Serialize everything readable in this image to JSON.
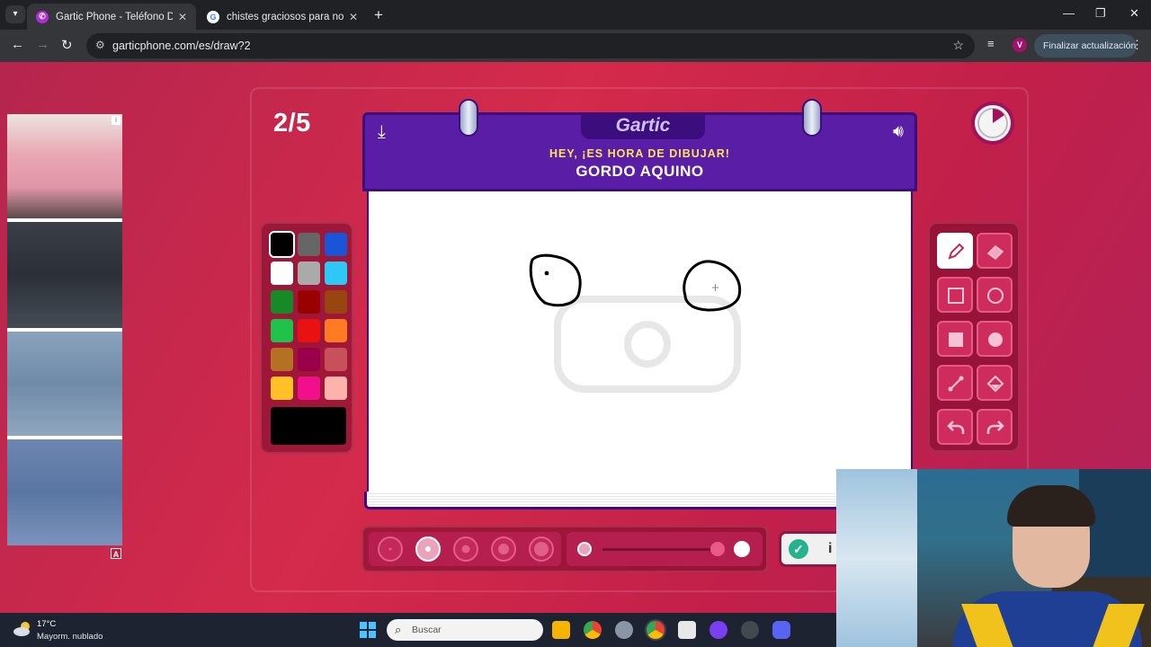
{
  "browser": {
    "tabs": [
      {
        "title": "Gartic Phone - Teléfono Descon",
        "active": true
      },
      {
        "title": "chistes graciosos para no parar",
        "active": false
      }
    ],
    "url": "garticphone.com/es/draw?2",
    "profile_initial": "V",
    "update_label": "Finalizar actualización"
  },
  "game": {
    "round": "2/5",
    "logo": "Gartic",
    "subtitle": "HEY, ¡ES HORA DE DIBUJAR!",
    "word": "GORDO AQUINO",
    "done_label": "i",
    "colors": [
      "#000000",
      "#666666",
      "#1a55d8",
      "#ffffff",
      "#aaaaaa",
      "#2ec8f6",
      "#158a26",
      "#990000",
      "#99450f",
      "#20c34a",
      "#ea1111",
      "#ff7a21",
      "#b37121",
      "#990049",
      "#c8505a",
      "#ffc126",
      "#f20f8c",
      "#fbb3ac"
    ],
    "selected_color": "#000000",
    "brush_sizes": 5,
    "selected_size": 2,
    "tools": [
      "pen-icon",
      "eraser-icon",
      "rect-outline-icon",
      "circle-outline-icon",
      "rect-fill-icon",
      "circle-fill-icon",
      "line-icon",
      "fill-bucket-icon",
      "undo-icon",
      "redo-icon"
    ]
  },
  "ad": {
    "badge": "A"
  },
  "taskbar": {
    "temperature": "17°C",
    "condition": "Mayorm. nublado",
    "search_placeholder": "Buscar"
  }
}
